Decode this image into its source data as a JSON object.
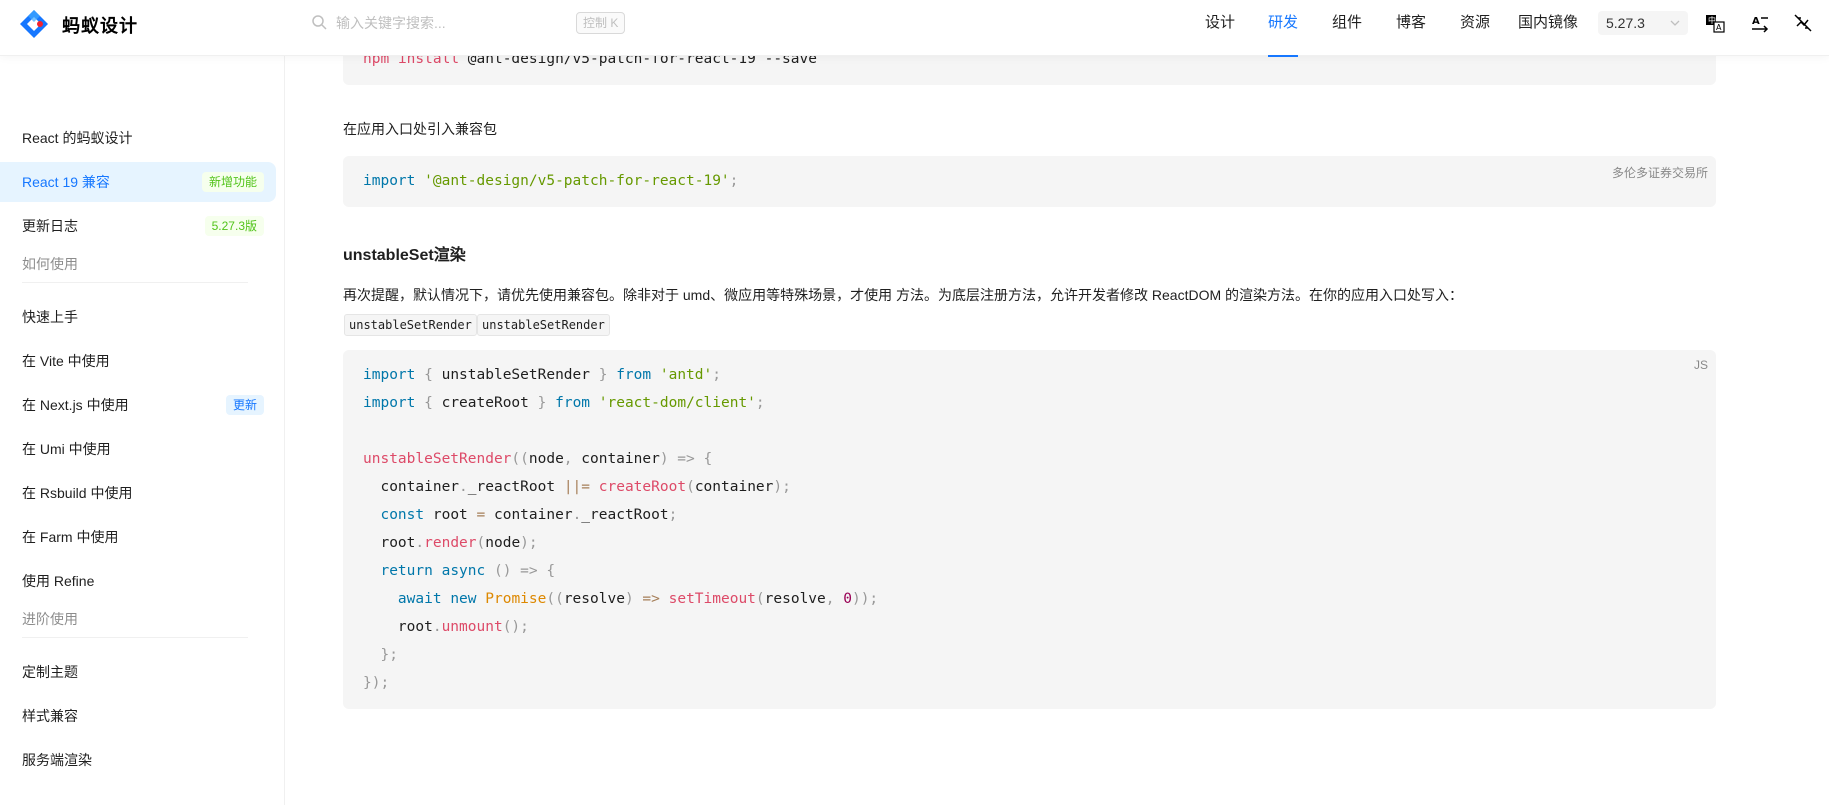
{
  "header": {
    "brand": "蚂蚁设计",
    "search_placeholder": "输入关键字搜索...",
    "shortcut": "控制 K",
    "nav": [
      "设计",
      "研发",
      "组件",
      "博客",
      "资源",
      "国内镜像"
    ],
    "active_nav": "研发",
    "version": "5.27.3"
  },
  "sidebar": {
    "items": [
      {
        "label": "React 的蚂蚁设计"
      },
      {
        "label": "React 19 兼容",
        "tag": "新增功能"
      },
      {
        "label": "更新日志",
        "tag": "5.27.3版"
      }
    ],
    "group1": "如何使用",
    "usage": [
      {
        "label": "快速上手"
      },
      {
        "label": "在 Vite 中使用"
      },
      {
        "label": "在 Next.js 中使用",
        "tag": "更新"
      },
      {
        "label": "在 Umi 中使用"
      },
      {
        "label": "在 Rsbuild 中使用"
      },
      {
        "label": "在 Farm 中使用"
      },
      {
        "label": "使用 Refine"
      }
    ],
    "group2": "进阶使用",
    "advanced": [
      {
        "label": "定制主题"
      },
      {
        "label": "样式兼容"
      },
      {
        "label": "服务端渲染"
      }
    ]
  },
  "content": {
    "install_cmd_npm": "npm",
    "install_cmd_install": "install",
    "install_cmd_rest": "@ant-design/v5-patch-for-react-19 --save",
    "para1": "在应用入口处引入兼容包",
    "import_kw": "import",
    "import_pkg": "'@ant-design/v5-patch-for-react-19'",
    "import_semi": ";",
    "block1_label": "多伦多证券交易所",
    "heading": "unstableSet渲染",
    "para2": "再次提醒，默认情况下，请优先使用兼容包。除非对于 umd、微应用等特殊场景，才使用 方法。为底层注册方法，允许开发者修改 ReactDOM 的渲染方法。在你的应用入口处写入：",
    "inline_codes": [
      "unstableSetRender",
      "unstableSetRender"
    ],
    "block2_label": "JS",
    "code": {
      "import": "import",
      "from": "from",
      "lb": "{ ",
      "rb": " }",
      "unstableSetRender": "unstableSetRender",
      "antd": "'antd'",
      "createRoot": "createRoot",
      "react_dom": "'react-dom/client'",
      "semi": ";",
      "paren_open": "((",
      "node": "node",
      "comma": ", ",
      "container": "container",
      "arrow_open": ") => {",
      "dot": ".",
      "_reactRoot": "_reactRoot",
      "or_eq": "||=",
      "lp": "(",
      "rp_semi": ");",
      "const": "const",
      "root": "root",
      "eq": "=",
      "render": "render",
      "return": "return",
      "async": "async",
      "empty_arrow": "() => {",
      "await": "await",
      "new": "new",
      "Promise": "Promise",
      "resolve": "resolve",
      "arrow": "=>",
      "setTimeout": "setTimeout",
      "zero": "0",
      "end_calls": "));",
      "unmount": "unmount",
      "call_end": "();",
      "close_inner": "};",
      "close_outer": "});"
    }
  }
}
